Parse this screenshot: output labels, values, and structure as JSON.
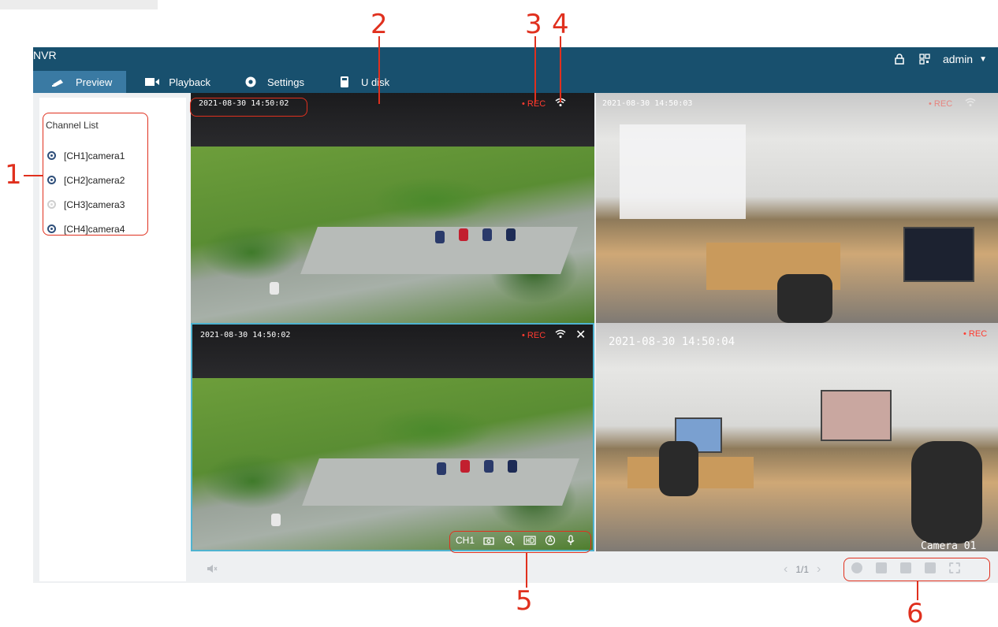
{
  "app": {
    "title": "NVR",
    "user": "admin",
    "tabs": [
      {
        "label": "Preview",
        "icon": "camera-icon",
        "active": true
      },
      {
        "label": "Playback",
        "icon": "playback-icon",
        "active": false
      },
      {
        "label": "Settings",
        "icon": "gear-icon",
        "active": false
      },
      {
        "label": "U disk",
        "icon": "usb-icon",
        "active": false
      }
    ],
    "top_icons": [
      "lock-icon",
      "qr-code-icon"
    ]
  },
  "sidebar": {
    "title": "Channel List",
    "channels": [
      {
        "label": "[CH1]camera1",
        "online": true
      },
      {
        "label": "[CH2]camera2",
        "online": true
      },
      {
        "label": "[CH3]camera3",
        "online": false
      },
      {
        "label": "[CH4]camera4",
        "online": true
      }
    ]
  },
  "videos": {
    "v1": {
      "timestamp": "2021-08-30 14:50:02",
      "rec": "• REC"
    },
    "v2": {
      "timestamp": "2021-08-30 14:50:03",
      "rec": "• REC"
    },
    "v3": {
      "timestamp": "2021-08-30 14:50:02",
      "rec": "• REC",
      "close": "✕",
      "toolbar": {
        "channel": "CH1",
        "icons": [
          "snapshot-icon",
          "zoom-icon",
          "hd-icon",
          "ptz-icon",
          "microphone-icon"
        ]
      }
    },
    "v4": {
      "timestamp": "2021-08-30 14:50:04",
      "rec": "• REC",
      "camera_label": "Camera 01"
    }
  },
  "bottom": {
    "mute_icon": "🔇",
    "page": "1/1",
    "prev": "‹",
    "next": "›"
  },
  "callouts": [
    "1",
    "2",
    "3",
    "4",
    "5",
    "6"
  ],
  "colors": {
    "accent": "#e0301e",
    "topbar": "#18506e",
    "active_tab": "#3a7aa3",
    "rec": "#ff3b30"
  }
}
